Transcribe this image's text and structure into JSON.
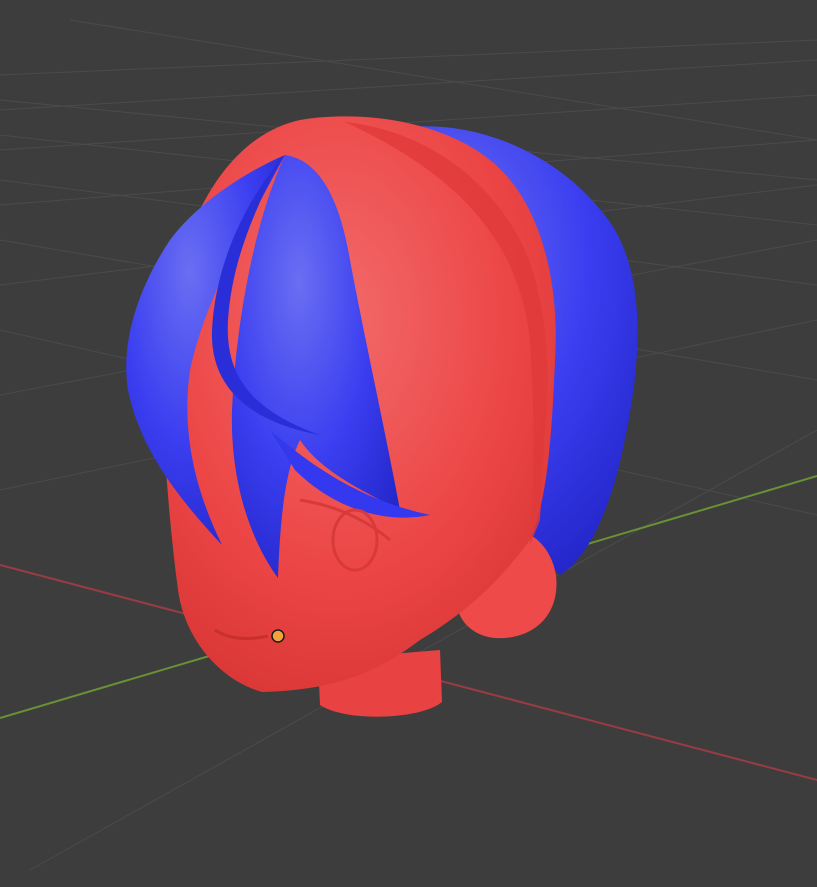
{
  "viewport": {
    "mode": "3D viewport",
    "background_color": "#3d3d3d",
    "grid_color": "#4a4a4a",
    "x_axis_color": "#9a3b46",
    "y_axis_color": "#6a9136"
  },
  "scene": {
    "object": "head",
    "materials": [
      {
        "part": "face",
        "color": "#ee4343"
      },
      {
        "part": "hair",
        "color": "#3438ee"
      }
    ],
    "origin_marker_color": "#f2a33a"
  }
}
